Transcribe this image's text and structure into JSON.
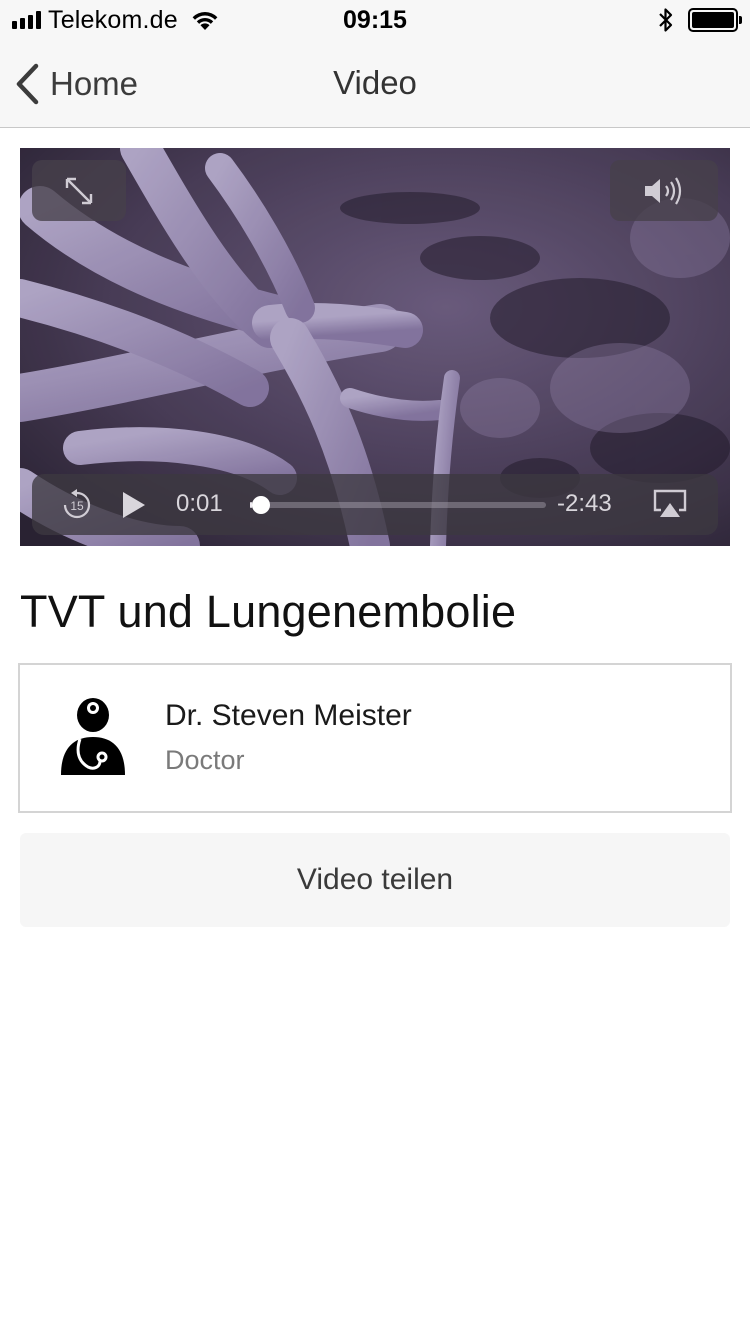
{
  "status_bar": {
    "carrier": "Telekom.de",
    "time": "09:15",
    "signal_bars": 4,
    "battery_level": 1.0
  },
  "nav": {
    "back_label": "Home",
    "title": "Video",
    "back_icon": "chevron-left-icon"
  },
  "player": {
    "current_time": "0:01",
    "remaining_time": "-2:43",
    "progress": 0.006,
    "skip_back_seconds": "15",
    "icons": [
      "fullscreen-icon",
      "volume-icon",
      "skip-back-15-icon",
      "play-icon",
      "airplay-icon"
    ]
  },
  "video": {
    "title": "TVT und Lungenembolie"
  },
  "author": {
    "name": "Dr. Steven Meister",
    "role": "Doctor",
    "icon": "doctor-icon"
  },
  "share": {
    "label": "Video teilen"
  },
  "colors": {
    "bar_background": "#f7f7f7",
    "video_tint": "#7a6a8c",
    "share_background": "#f6f6f6"
  }
}
